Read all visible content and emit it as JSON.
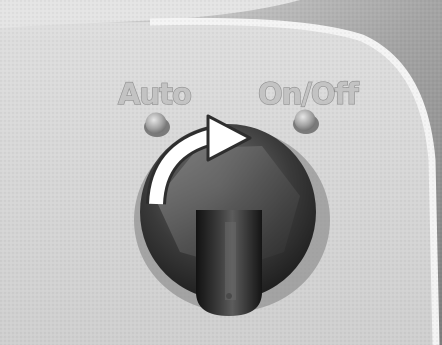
{
  "labels": {
    "auto": "Auto",
    "on_off": "On/Off"
  },
  "icons": {
    "rotation_arrow": "clockwise-arrow-icon",
    "auto_light": "indicator-light-icon",
    "on_off_light": "indicator-light-icon"
  },
  "colors": {
    "panel": "#d7d7d7",
    "housing": "#a9a9a9",
    "knob": "#262626",
    "arrow": "#ffffff",
    "indicator": "#a0a0a0"
  }
}
